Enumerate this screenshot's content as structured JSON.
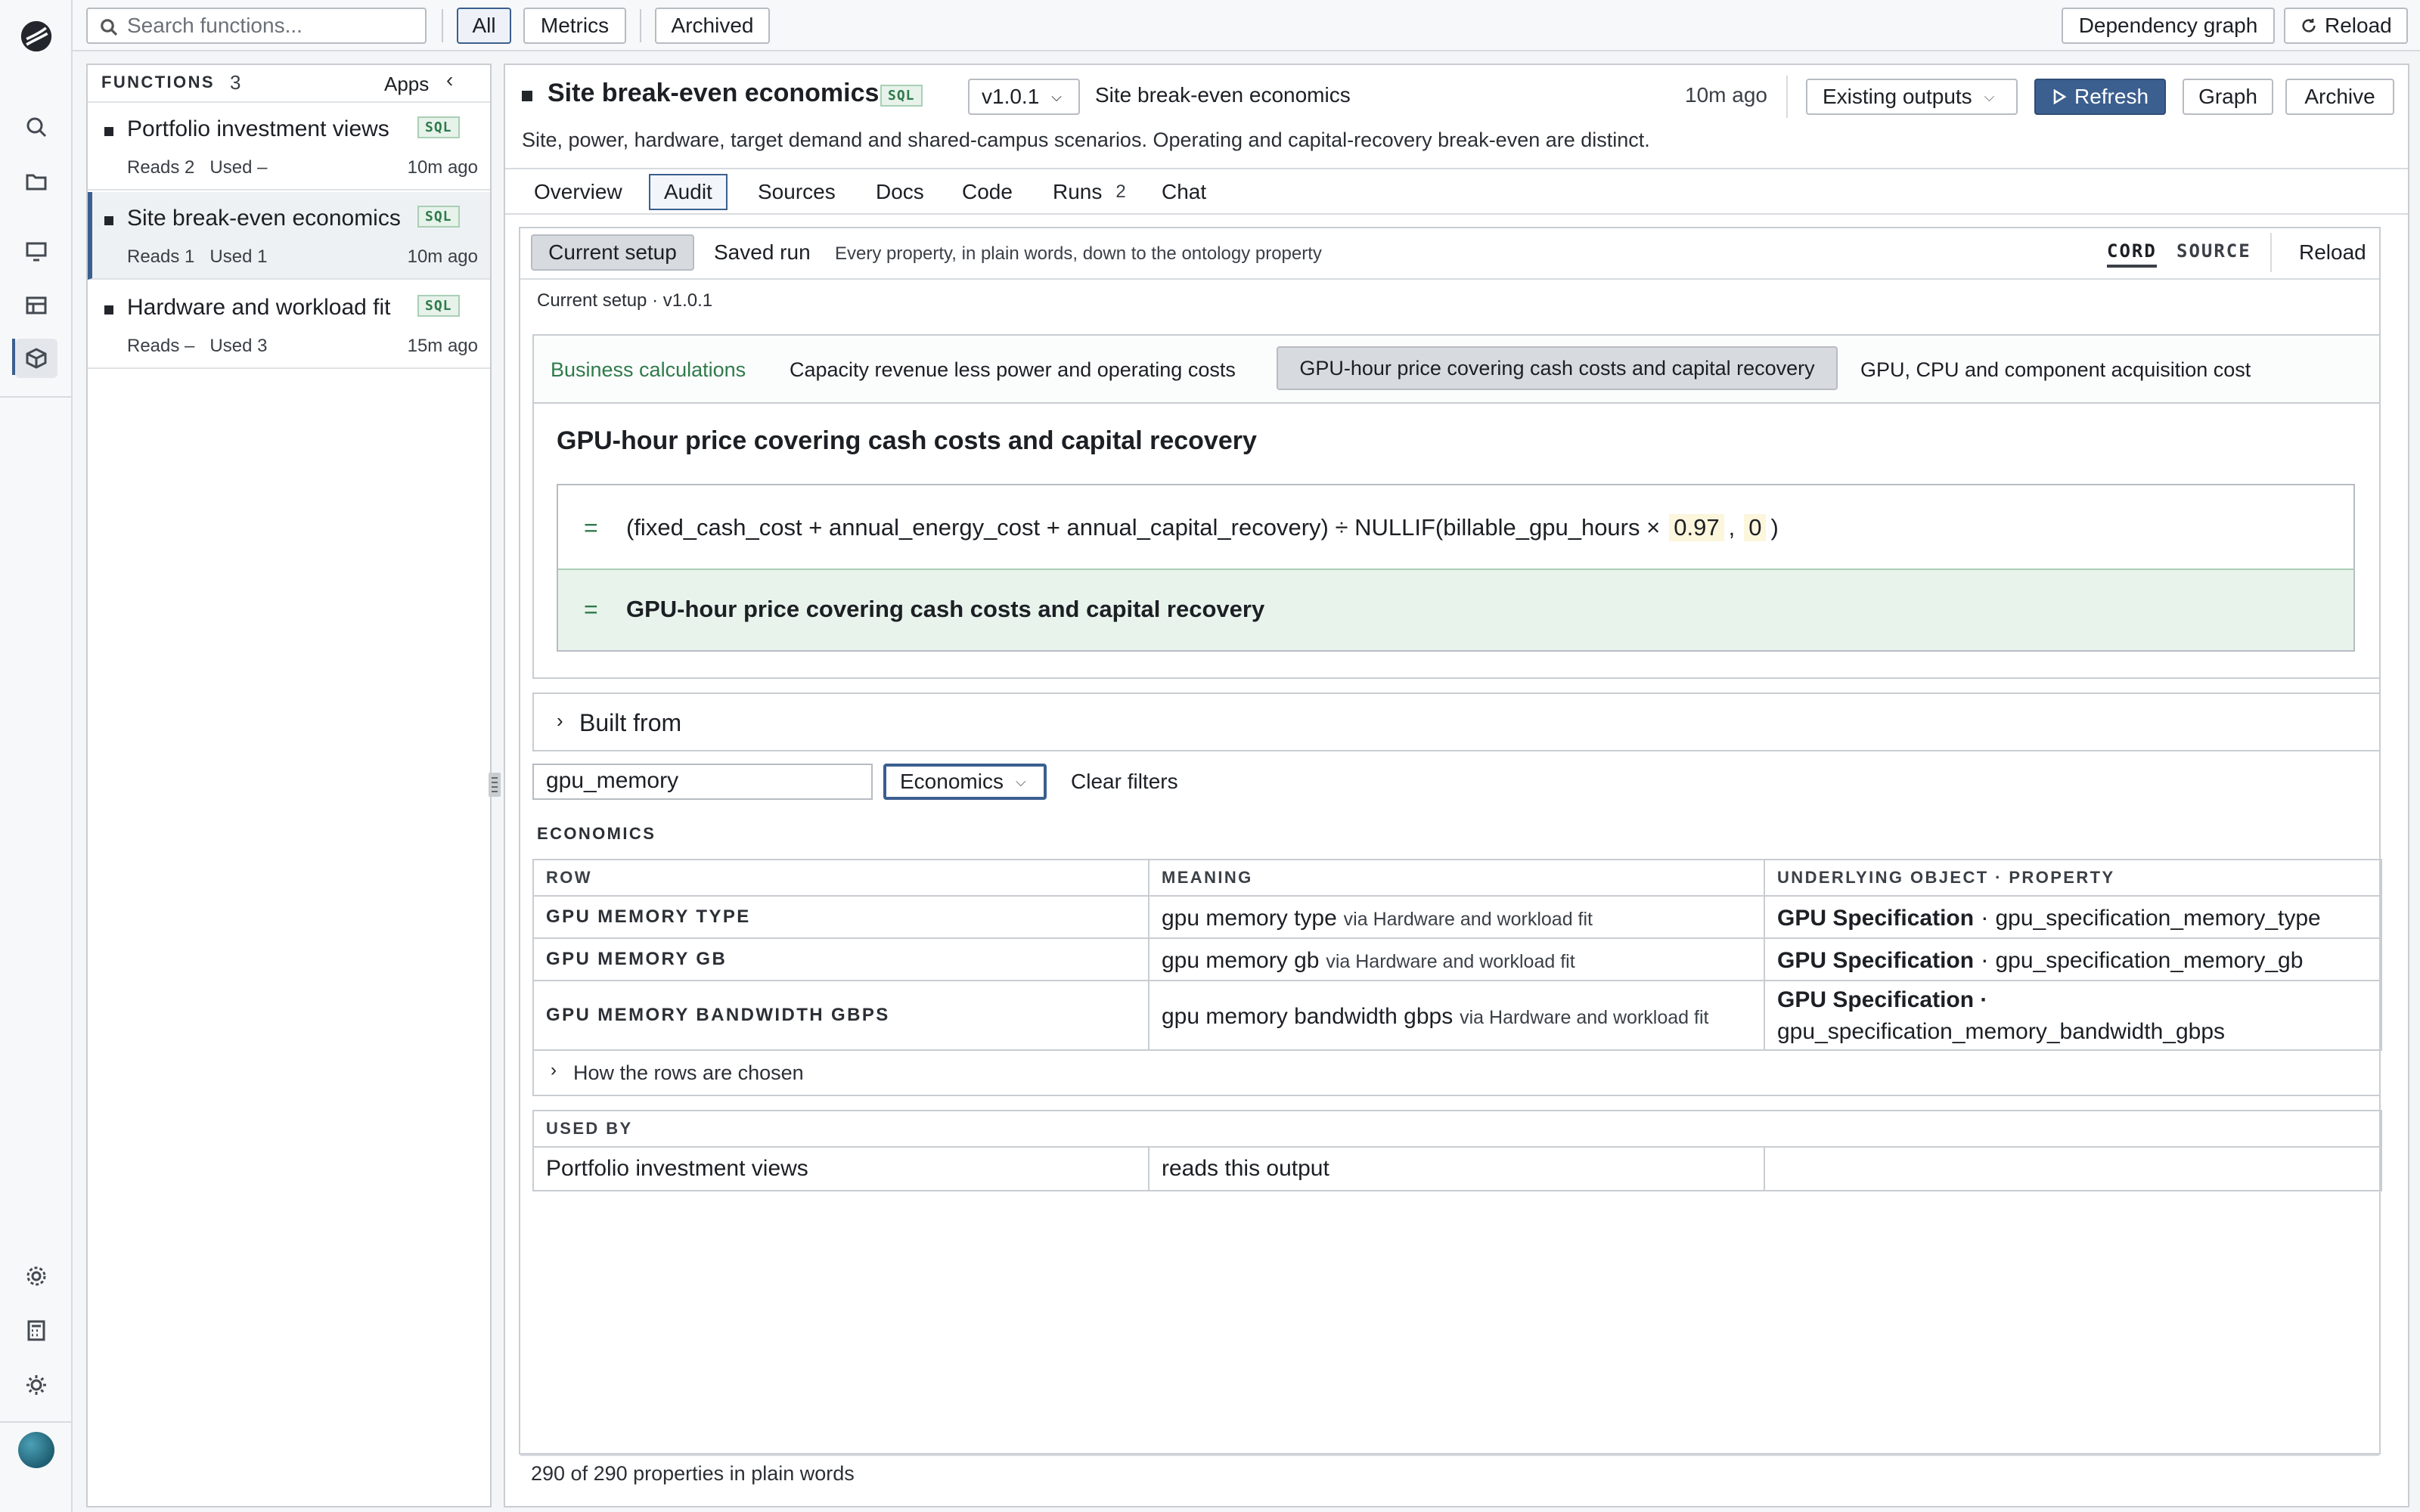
{
  "topbar": {
    "search_placeholder": "Search functions...",
    "filters": [
      "All",
      "Metrics",
      "Archived"
    ],
    "dependency_graph": "Dependency graph",
    "reload": "Reload"
  },
  "functions_panel": {
    "title": "FUNCTIONS",
    "count": "3",
    "apps": "Apps",
    "items": [
      {
        "title": "Portfolio investment views",
        "badge": "SQL",
        "reads": "Reads 2",
        "used": "Used –",
        "time": "10m ago"
      },
      {
        "title": "Site break-even economics",
        "badge": "SQL",
        "reads": "Reads 1",
        "used": "Used 1",
        "time": "10m ago"
      },
      {
        "title": "Hardware and workload fit",
        "badge": "SQL",
        "reads": "Reads –",
        "used": "Used 3",
        "time": "15m ago"
      }
    ]
  },
  "header": {
    "title": "Site break-even economics",
    "badge": "SQL",
    "version": "v1.0.1",
    "subtitle_name": "Site break-even economics",
    "time": "10m ago",
    "outputs_select": "Existing outputs",
    "refresh": "Refresh",
    "graph": "Graph",
    "archive": "Archive",
    "description": "Site, power, hardware, target demand and shared-campus scenarios. Operating and capital-recovery break-even are distinct."
  },
  "tabs": [
    {
      "label": "Overview"
    },
    {
      "label": "Audit",
      "active": true
    },
    {
      "label": "Sources"
    },
    {
      "label": "Docs"
    },
    {
      "label": "Code"
    },
    {
      "label": "Runs",
      "count": "2"
    },
    {
      "label": "Chat"
    }
  ],
  "audit": {
    "current_setup": "Current setup",
    "saved_run": "Saved run",
    "description": "Every property, in plain words, down to the ontology property",
    "toggle_cord": "CORD",
    "toggle_source": "SOURCE",
    "reload": "Reload",
    "setup_line": "Current setup · v1.0.1",
    "calc_tabs": {
      "label": "Business calculations",
      "items": [
        "Capacity revenue less power and operating costs",
        "GPU-hour price covering cash costs and capital recovery",
        "GPU, CPU and component acquisition cost"
      ]
    },
    "calc_title": "GPU-hour price covering cash costs and capital recovery",
    "formula": {
      "eq": "=",
      "expression": "(fixed_cash_cost + annual_energy_cost + annual_capital_recovery) ÷ NULLIF(billable_gpu_hours ×",
      "const1": "0.97",
      "comma": ",",
      "const2": "0",
      "close": ")",
      "result": "GPU-hour price covering cash costs and capital recovery"
    },
    "built_from": "Built from",
    "filter_value": "gpu_memory",
    "filter_select": "Economics",
    "clear_filters": "Clear filters",
    "section": "ECONOMICS",
    "columns": [
      "ROW",
      "MEANING",
      "UNDERLYING OBJECT · PROPERTY"
    ],
    "rows": [
      {
        "row": "GPU MEMORY TYPE",
        "meaning": "gpu memory type",
        "via": "via Hardware and workload fit",
        "object": "GPU Specification",
        "property": "gpu_specification_memory_type"
      },
      {
        "row": "GPU MEMORY GB",
        "meaning": "gpu memory gb",
        "via": "via Hardware and workload fit",
        "object": "GPU Specification",
        "property": "gpu_specification_memory_gb"
      },
      {
        "row": "GPU MEMORY BANDWIDTH GBPS",
        "meaning": "gpu memory bandwidth gbps",
        "via": "via Hardware and workload fit",
        "object": "GPU Specification ·",
        "property": "gpu_specification_memory_bandwidth_gbps"
      }
    ],
    "how_rows": "How the rows are chosen",
    "used_by_title": "USED BY",
    "used_by": [
      {
        "name": "Portfolio investment views",
        "relation": "reads this output"
      }
    ],
    "footer": "290 of 290 properties in plain words"
  },
  "colors": {
    "accent": "#3b5f8f",
    "sql_green": "#2f7a4b",
    "result_bg": "#e8f3ec"
  }
}
